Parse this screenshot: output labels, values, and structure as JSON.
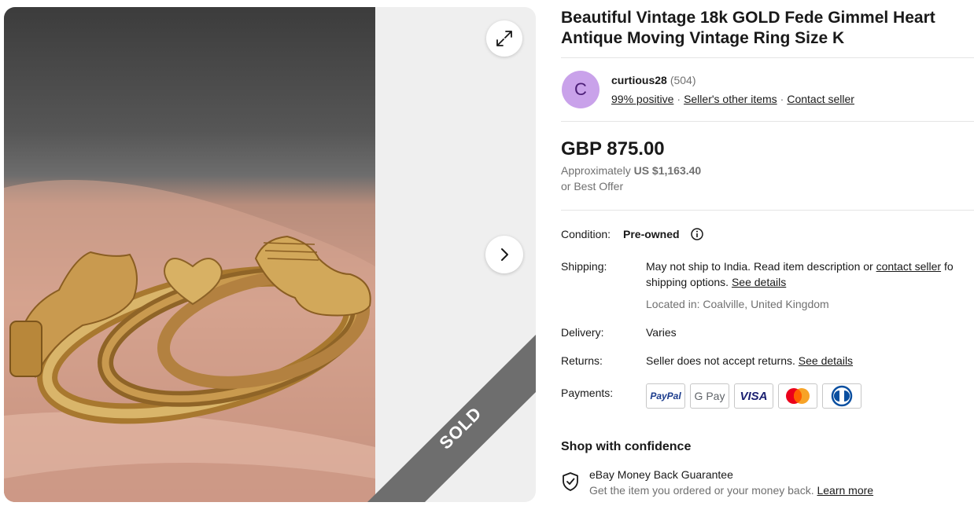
{
  "listing": {
    "title": "Beautiful Vintage 18k GOLD Fede Gimmel Heart Antique Moving Vintage Ring Size K",
    "sold_label": "SOLD"
  },
  "seller": {
    "avatar_letter": "C",
    "name": "curtious28",
    "feedback_count": "(504)",
    "positive": "99% positive",
    "other_items": "Seller's other items",
    "contact": "Contact seller"
  },
  "pricing": {
    "price": "GBP 875.00",
    "approx_label": "Approximately",
    "approx_value": "US $1,163.40",
    "best_offer": "or Best Offer"
  },
  "details": {
    "condition_label": "Condition:",
    "condition_value": "Pre-owned",
    "shipping_label": "Shipping:",
    "shipping_text_1": "May not ship to India. Read item description or ",
    "shipping_contact_link": "contact seller",
    "shipping_text_1b": " fo",
    "shipping_text_2": "shipping options. ",
    "shipping_see_details": "See details",
    "located_in": "Located in: Coalville, United Kingdom",
    "delivery_label": "Delivery:",
    "delivery_value": "Varies",
    "returns_label": "Returns:",
    "returns_text": "Seller does not accept returns. ",
    "returns_see_details": "See details",
    "payments_label": "Payments:"
  },
  "payments": {
    "paypal": "PayPal",
    "gpay": "G Pay",
    "visa": "VISA"
  },
  "confidence": {
    "heading": "Shop with confidence",
    "guarantee_title": "eBay Money Back Guarantee",
    "guarantee_text": "Get the item you ordered or your money back. ",
    "learn_more": "Learn more"
  },
  "icons": {
    "expand": "expand-icon",
    "next": "chevron-right-icon",
    "info": "info-icon",
    "shield": "shield-check-icon"
  },
  "colors": {
    "avatar_bg": "#c9a2ea",
    "sold_ribbon": "#6e6e6e",
    "gold": "#c9a24e"
  }
}
